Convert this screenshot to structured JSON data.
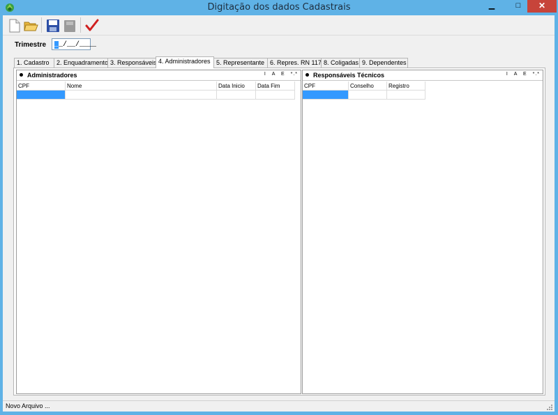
{
  "window": {
    "title": "Digitação dos dados Cadastrais",
    "min_glyph": "▁",
    "max_glyph": "□",
    "close_glyph": "✕"
  },
  "toolbar": {
    "icons": [
      "new-file-icon",
      "open-folder-icon",
      "save-icon",
      "disabled-save-icon",
      "confirm-check-icon"
    ]
  },
  "trimestre": {
    "label": "Trimestre",
    "mask_cursor": "_",
    "mask_rest": "_/__/____"
  },
  "tabs": [
    {
      "label": "1. Cadastro",
      "active": false
    },
    {
      "label": "2. Enquadramento",
      "active": false
    },
    {
      "label": "3. Responsáveis",
      "active": false
    },
    {
      "label": "4. Administradores",
      "active": true
    },
    {
      "label": "5. Representante",
      "active": false
    },
    {
      "label": "6. Repres. RN 117",
      "active": false
    },
    {
      "label": "8. Coligadas",
      "active": false
    },
    {
      "label": "9. Dependentes",
      "active": false
    }
  ],
  "administradores": {
    "title": "Administradores",
    "actions": [
      "I",
      "A",
      "E",
      "*.*"
    ],
    "columns": [
      "CPF",
      "Nome",
      "Data Inicio",
      "Data Fim"
    ]
  },
  "responsaveis_tecnicos": {
    "title": "Responsáveis Técnicos",
    "actions": [
      "I",
      "A",
      "E",
      "*.*"
    ],
    "columns": [
      "CPF",
      "Conselho",
      "Registro"
    ]
  },
  "status": {
    "text": "Novo Arquivo ..."
  },
  "colors": {
    "window_frame": "#5fb2e6",
    "close_button": "#c7443a",
    "selection": "#3399ff",
    "confirm_check": "#d02020"
  }
}
